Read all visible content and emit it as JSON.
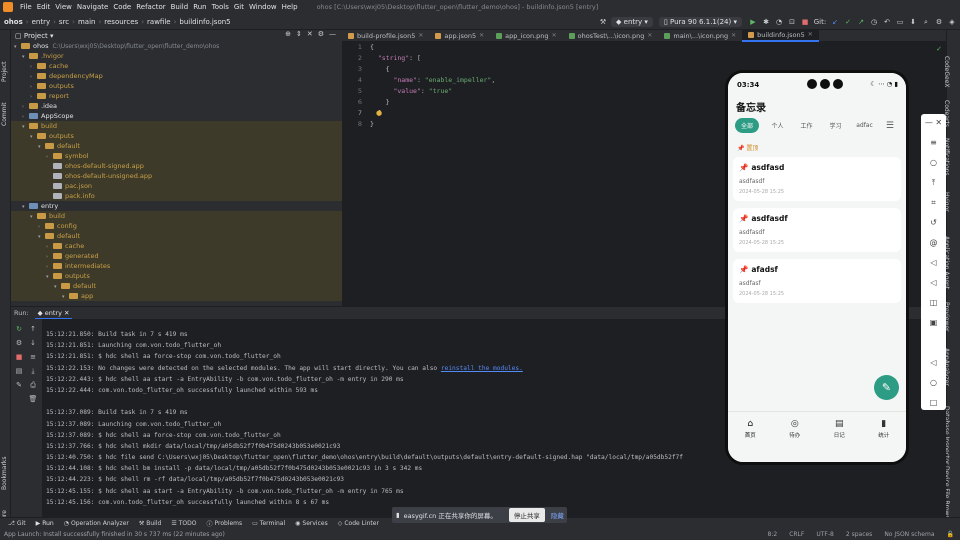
{
  "menubar": {
    "items": [
      "File",
      "Edit",
      "View",
      "Navigate",
      "Code",
      "Refactor",
      "Build",
      "Run",
      "Tools",
      "Git",
      "Window",
      "Help"
    ],
    "path": "ohos [C:\\Users\\wxj05\\Desktop\\flutter_open\\flutter_demo\\ohos] - buildinfo.json5 [entry]"
  },
  "navbar": {
    "crumbs": [
      "ohos",
      "entry",
      "src",
      "main",
      "resources",
      "rawfile",
      "buildinfo.json5"
    ],
    "run_config": "entry",
    "device": "Pura 90 6.1.1(24)",
    "git_label": "Git:"
  },
  "project": {
    "title": "Project",
    "rows": [
      {
        "indent": 0,
        "arrow": "▾",
        "icon": "fo",
        "text": "ohos",
        "sub": "C:\\Users\\wxj05\\Desktop\\flutter_open\\flutter_demo\\ohos",
        "style": ""
      },
      {
        "indent": 1,
        "arrow": "▾",
        "icon": "fo",
        "text": ".hvigor",
        "sub": "",
        "style": "ig"
      },
      {
        "indent": 2,
        "arrow": "›",
        "icon": "fo",
        "text": "cache",
        "sub": "",
        "style": "ig"
      },
      {
        "indent": 2,
        "arrow": "›",
        "icon": "fo",
        "text": "dependencyMap",
        "sub": "",
        "style": "ig"
      },
      {
        "indent": 2,
        "arrow": "›",
        "icon": "fo",
        "text": "outputs",
        "sub": "",
        "style": "ig"
      },
      {
        "indent": 2,
        "arrow": "›",
        "icon": "fo",
        "text": "report",
        "sub": "",
        "style": "ig"
      },
      {
        "indent": 1,
        "arrow": "›",
        "icon": "fo",
        "text": ".idea",
        "sub": "",
        "style": ""
      },
      {
        "indent": 1,
        "arrow": "›",
        "icon": "fb",
        "text": "AppScope",
        "sub": "",
        "style": ""
      },
      {
        "indent": 1,
        "arrow": "▾",
        "icon": "fo",
        "text": "build",
        "sub": "",
        "style": "ex"
      },
      {
        "indent": 2,
        "arrow": "▾",
        "icon": "fo",
        "text": "outputs",
        "sub": "",
        "style": "ex"
      },
      {
        "indent": 3,
        "arrow": "▾",
        "icon": "fo",
        "text": "default",
        "sub": "",
        "style": "ex"
      },
      {
        "indent": 4,
        "arrow": "›",
        "icon": "fo",
        "text": "symbol",
        "sub": "",
        "style": "ex"
      },
      {
        "indent": 4,
        "arrow": "",
        "icon": "ff",
        "text": "ohos-default-signed.app",
        "sub": "",
        "style": "ex"
      },
      {
        "indent": 4,
        "arrow": "",
        "icon": "ff",
        "text": "ohos-default-unsigned.app",
        "sub": "",
        "style": "ex"
      },
      {
        "indent": 4,
        "arrow": "",
        "icon": "ff",
        "text": "pac.json",
        "sub": "",
        "style": "ex"
      },
      {
        "indent": 4,
        "arrow": "",
        "icon": "ff",
        "text": "pack.info",
        "sub": "",
        "style": "ex"
      },
      {
        "indent": 1,
        "arrow": "▾",
        "icon": "fb",
        "text": "entry",
        "sub": "",
        "style": ""
      },
      {
        "indent": 2,
        "arrow": "▾",
        "icon": "fo",
        "text": "build",
        "sub": "",
        "style": "ex"
      },
      {
        "indent": 3,
        "arrow": "›",
        "icon": "fo",
        "text": "config",
        "sub": "",
        "style": "ex"
      },
      {
        "indent": 3,
        "arrow": "▾",
        "icon": "fo",
        "text": "default",
        "sub": "",
        "style": "ex"
      },
      {
        "indent": 4,
        "arrow": "›",
        "icon": "fo",
        "text": "cache",
        "sub": "",
        "style": "ex"
      },
      {
        "indent": 4,
        "arrow": "›",
        "icon": "fo",
        "text": "generated",
        "sub": "",
        "style": "ex"
      },
      {
        "indent": 4,
        "arrow": "›",
        "icon": "fo",
        "text": "intermediates",
        "sub": "",
        "style": "ex"
      },
      {
        "indent": 4,
        "arrow": "▾",
        "icon": "fo",
        "text": "outputs",
        "sub": "",
        "style": "ex"
      },
      {
        "indent": 5,
        "arrow": "▾",
        "icon": "fo",
        "text": "default",
        "sub": "",
        "style": "ex"
      },
      {
        "indent": 6,
        "arrow": "▾",
        "icon": "fo",
        "text": "app",
        "sub": "",
        "style": "ex"
      }
    ]
  },
  "editor_tabs": [
    {
      "label": "build-profile.json5",
      "icon": "json",
      "active": false
    },
    {
      "label": "app.json5",
      "icon": "json",
      "active": false
    },
    {
      "label": "app_icon.png",
      "icon": "png",
      "active": false
    },
    {
      "label": "ohosTest\\...\\icon.png",
      "icon": "png",
      "active": false
    },
    {
      "label": "main\\...\\icon.png",
      "icon": "png",
      "active": false
    },
    {
      "label": "buildinfo.json5",
      "icon": "json",
      "active": true
    }
  ],
  "code": {
    "line_numbers": [
      "1",
      "2",
      "3",
      "4",
      "5",
      "6",
      "7",
      "8"
    ],
    "current_line": 7
  },
  "run": {
    "label": "Run:",
    "tab": "entry",
    "lines": [
      "15:12:21.850: Build task in 7 s 419 ms",
      "15:12:21.851: Launching com.von.todo_flutter_oh",
      "15:12:21.851: $ hdc shell aa force-stop com.von.todo_flutter_oh",
      "15:12:22.153: No changes were detected on the selected modules. The app will start directly. You can also ",
      "15:12:22.443: $ hdc shell aa start -a EntryAbility -b com.von.todo_flutter_oh -m entry in 290 ms",
      "15:12:22.444: com.von.todo_flutter_oh successfully launched within 593 ms",
      "",
      "15:12:37.089: Build task in 7 s 419 ms",
      "15:12:37.089: Launching com.von.todo_flutter_oh",
      "15:12:37.089: $ hdc shell aa force-stop com.von.todo_flutter_oh",
      "15:12:37.766: $ hdc shell mkdir data/local/tmp/a05db52f7f0b475d0243b053e0021c93",
      "15:12:40.750: $ hdc file send C:\\Users\\wxj05\\Desktop\\flutter_open\\flutter_demo\\ohos\\entry\\build\\default\\outputs\\default\\entry-default-signed.hap \"data/local/tmp/a05db52f7f",
      "15:12:44.108: $ hdc shell bm install -p data/local/tmp/a05db52f7f0b475d0243b053e0021c93 in 3 s 342 ms",
      "15:12:44.223: $ hdc shell rm -rf data/local/tmp/a05db52f7f0b475d0243b053e0021c93",
      "15:12:45.155: $ hdc shell aa start -a EntryAbility -b com.von.todo_flutter_oh -m entry in 765 ms",
      "15:12:45.156: com.von.todo_flutter_oh successfully launched within 8 s 67 ms"
    ],
    "link_text": "reinstall the modules."
  },
  "bottom_tabs": [
    "Git",
    "Run",
    "Operation Analyzer",
    "Build",
    "TODO",
    "Problems",
    "Terminal",
    "Services",
    "Code Linter"
  ],
  "status": {
    "message": "App Launch: Install successfully finished in 30 s 737 ms (22 minutes ago)",
    "position": "8:2",
    "line_sep": "CRLF",
    "encoding": "UTF-8",
    "indent": "2 spaces",
    "schema": "No JSON schema"
  },
  "share_bar": {
    "text": "easygif.cn 正在共享你的屏幕。",
    "stop": "停止共享",
    "hide": "隐藏"
  },
  "left_strip": [
    "Project",
    "Commit",
    "Bookmarks",
    "Structure"
  ],
  "right_strip": [
    "CodeGeeX",
    "Notifications",
    "Codearts",
    "Hvigor",
    "Application Agent",
    "Previewer",
    "AppAnalyzer",
    "Database Inspector",
    "Device File Browser"
  ],
  "phone": {
    "time": "03:34",
    "title": "备忘录",
    "tabs": [
      "全部",
      "个人",
      "工作",
      "学习",
      "adfac"
    ],
    "pinned_label": "置顶",
    "notes": [
      {
        "title": "asdfasd",
        "body": "asdfasdf",
        "date": "2024-05-28 15:25"
      },
      {
        "title": "asdfasdf",
        "body": "asdfasdf",
        "date": "2024-05-28 15:25"
      },
      {
        "title": "afadsf",
        "body": "asdfasf",
        "date": "2024-05-28 15:25"
      }
    ],
    "nav": [
      "首页",
      "待办",
      "日记",
      "统计"
    ]
  }
}
